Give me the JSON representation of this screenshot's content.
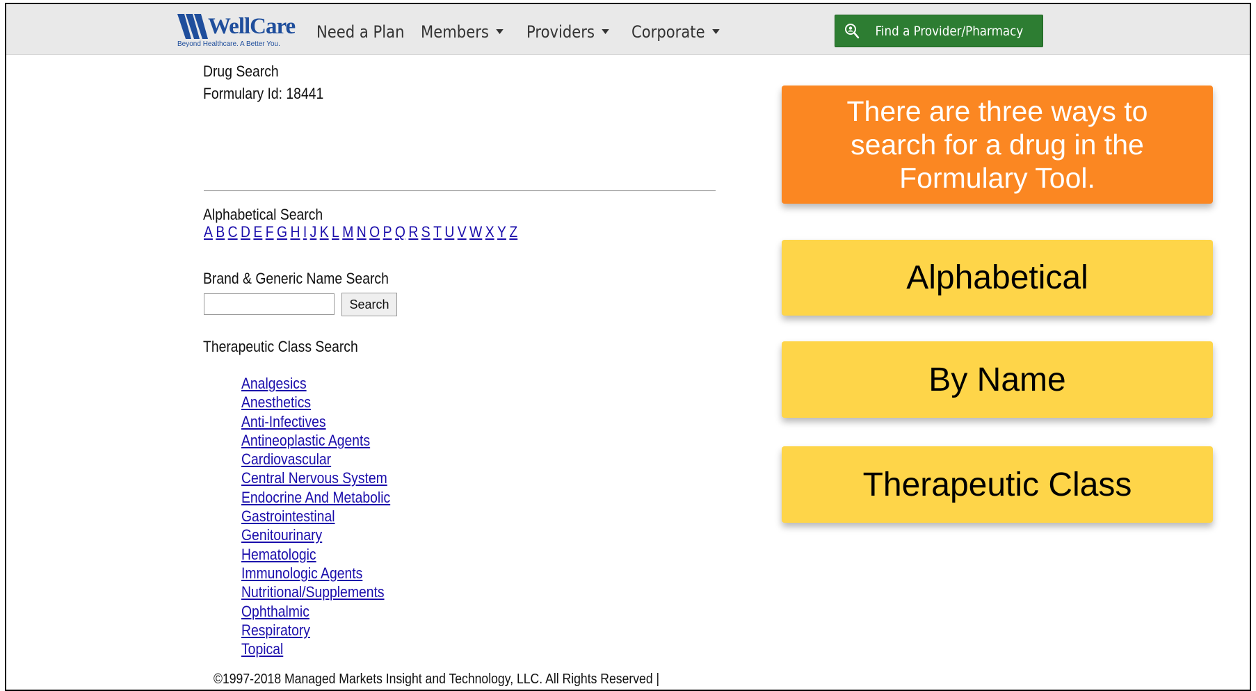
{
  "header": {
    "logo_text": "WellCare",
    "logo_tagline": "Beyond Healthcare. A Better You.",
    "nav": [
      {
        "label": "Need a Plan",
        "has_menu": false
      },
      {
        "label": "Members",
        "has_menu": true
      },
      {
        "label": "Providers",
        "has_menu": true
      },
      {
        "label": "Corporate",
        "has_menu": true
      }
    ],
    "find_button": "Find a Provider/Pharmacy",
    "find_button_color": "#2d7d32"
  },
  "main": {
    "title": "Drug Search",
    "formulary": "Formulary Id: 18441",
    "alpha_heading": "Alphabetical Search",
    "letters": [
      "A",
      "B",
      "C",
      "D",
      "E",
      "F",
      "G",
      "H",
      "I",
      "J",
      "K",
      "L",
      "M",
      "N",
      "O",
      "P",
      "Q",
      "R",
      "S",
      "T",
      "U",
      "V",
      "W",
      "X",
      "Y",
      "Z"
    ],
    "name_search_heading": "Brand & Generic Name Search",
    "search_value": "",
    "search_button": "Search",
    "class_heading": "Therapeutic Class Search",
    "classes": [
      "Analgesics",
      "Anesthetics",
      "Anti-Infectives",
      "Antineoplastic Agents",
      "Cardiovascular",
      "Central Nervous System",
      "Endocrine And Metabolic",
      "Gastrointestinal",
      "Genitourinary",
      "Hematologic",
      "Immunologic Agents",
      "Nutritional/Supplements",
      "Ophthalmic",
      "Respiratory",
      "Topical"
    ],
    "footer": "©1997-2018 Managed Markets Insight and Technology, LLC. All Rights Reserved |"
  },
  "callouts": {
    "intro": "There are three ways to search for a drug in the Formulary Tool.",
    "options": [
      "Alphabetical",
      "By Name",
      "Therapeutic Class"
    ],
    "intro_color": "#fb8722",
    "option_color": "#fed549"
  }
}
